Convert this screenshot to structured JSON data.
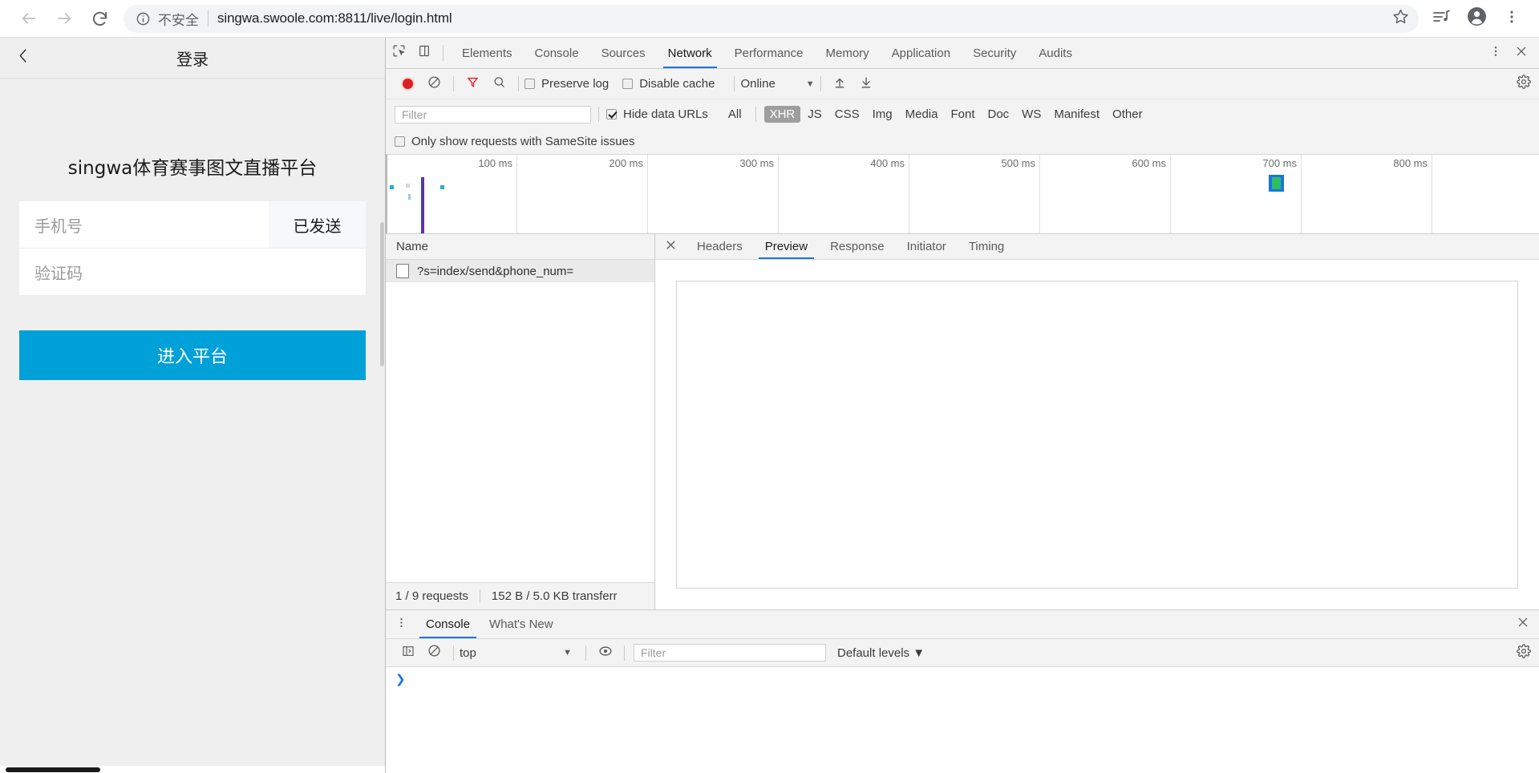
{
  "browser": {
    "back_icon": "back-arrow-icon",
    "forward_icon": "forward-arrow-icon",
    "reload_icon": "reload-icon",
    "security_label": "不安全",
    "url": "singwa.swoole.com:8811/live/login.html",
    "star_icon": "bookmark-star-icon",
    "media_icon": "media-playlist-icon",
    "profile_icon": "profile-avatar-icon",
    "menu_icon": "three-dot-menu-icon"
  },
  "page": {
    "back_icon": "chevron-left-icon",
    "title": "登录",
    "brand": "singwa体育赛事图文直播平台",
    "phone_placeholder": "手机号",
    "send_code_label": "已发送",
    "code_placeholder": "验证码",
    "submit_label": "进入平台",
    "accent_color": "#00a0d8"
  },
  "devtools": {
    "inspect_icon": "inspect-element-icon",
    "device_icon": "device-toolbar-icon",
    "tabs": [
      {
        "label": "Elements",
        "active": false
      },
      {
        "label": "Console",
        "active": false
      },
      {
        "label": "Sources",
        "active": false
      },
      {
        "label": "Network",
        "active": true
      },
      {
        "label": "Performance",
        "active": false
      },
      {
        "label": "Memory",
        "active": false
      },
      {
        "label": "Application",
        "active": false
      },
      {
        "label": "Security",
        "active": false
      },
      {
        "label": "Audits",
        "active": false
      }
    ],
    "more_icon": "three-dot-menu-icon",
    "close_icon": "close-icon",
    "toolbar": {
      "record_icon": "record-stop-icon",
      "clear_icon": "clear-icon",
      "filter_icon": "filter-funnel-icon",
      "search_icon": "search-icon",
      "preserve_log_label": "Preserve log",
      "preserve_log_checked": false,
      "disable_cache_label": "Disable cache",
      "disable_cache_checked": false,
      "throttle_value": "Online",
      "import_icon": "import-har-icon",
      "export_icon": "export-har-icon",
      "settings_icon": "gear-icon"
    },
    "filterbar": {
      "filter_placeholder": "Filter",
      "hide_data_urls_label": "Hide data URLs",
      "hide_data_urls_checked": true,
      "types": [
        {
          "label": "All",
          "active": false
        },
        {
          "label": "XHR",
          "active": true
        },
        {
          "label": "JS",
          "active": false
        },
        {
          "label": "CSS",
          "active": false
        },
        {
          "label": "Img",
          "active": false
        },
        {
          "label": "Media",
          "active": false
        },
        {
          "label": "Font",
          "active": false
        },
        {
          "label": "Doc",
          "active": false
        },
        {
          "label": "WS",
          "active": false
        },
        {
          "label": "Manifest",
          "active": false
        },
        {
          "label": "Other",
          "active": false
        }
      ],
      "samesite_label": "Only show requests with SameSite issues",
      "samesite_checked": false
    },
    "overview": {
      "ticks": [
        "100 ms",
        "200 ms",
        "300 ms",
        "400 ms",
        "500 ms",
        "600 ms",
        "700 ms",
        "800 ms"
      ]
    },
    "request_list": {
      "column_header": "Name",
      "rows": [
        {
          "name": "?s=index/send&phone_num=",
          "selected": true
        }
      ],
      "status_requests": "1 / 9 requests",
      "status_transferred": "152 B / 5.0 KB transferr"
    },
    "detail": {
      "close_icon": "close-icon",
      "tabs": [
        {
          "label": "Headers",
          "active": false
        },
        {
          "label": "Preview",
          "active": true
        },
        {
          "label": "Response",
          "active": false
        },
        {
          "label": "Initiator",
          "active": false
        },
        {
          "label": "Timing",
          "active": false
        }
      ]
    },
    "drawer": {
      "more_icon": "three-dot-menu-icon",
      "tabs": [
        {
          "label": "Console",
          "active": true
        },
        {
          "label": "What's New",
          "active": false
        }
      ],
      "close_icon": "close-icon",
      "sidebar_icon": "console-sidebar-icon",
      "clear_icon": "clear-console-icon",
      "context_value": "top",
      "eye_icon": "live-expression-icon",
      "filter_placeholder": "Filter",
      "levels_label": "Default levels",
      "settings_icon": "gear-icon",
      "prompt_glyph": "❯"
    }
  }
}
